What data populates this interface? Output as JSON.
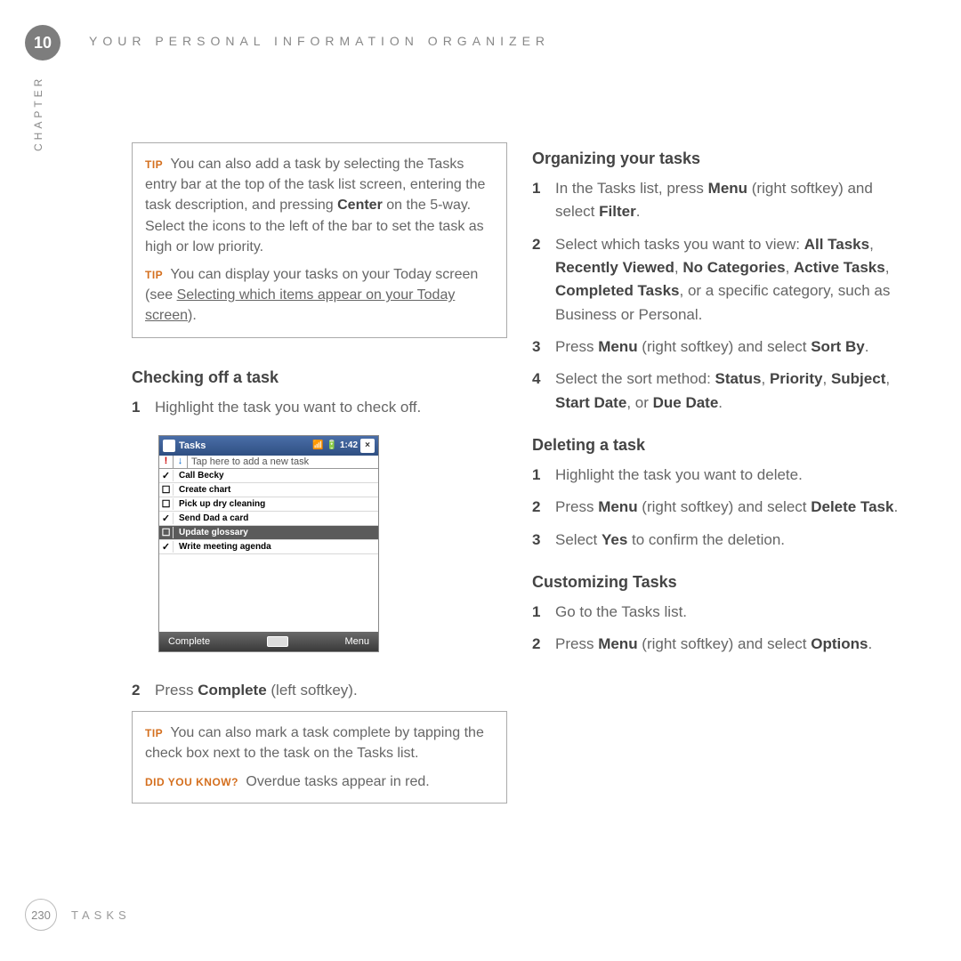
{
  "chapter": {
    "number": "10",
    "label": "CHAPTER"
  },
  "header": "YOUR PERSONAL INFORMATION ORGANIZER",
  "footer": {
    "page": "230",
    "section": "TASKS"
  },
  "left": {
    "tipbox1": {
      "tip1_label": "TIP",
      "tip1_a": "You can also add a task by selecting the Tasks entry bar at the top of the task list screen, entering the task description, and pressing ",
      "tip1_bold": "Center",
      "tip1_b": " on the 5-way. Select the icons to the left of the bar to set the task as high or low priority.",
      "tip2_label": "TIP",
      "tip2_a": "You can display your tasks on your Today screen (see ",
      "tip2_link": "Selecting which items appear on your Today screen",
      "tip2_b": ")."
    },
    "sec1_title": "Checking off a task",
    "step1_num": "1",
    "step1_txt": "Highlight the task you want to check off.",
    "phone": {
      "title": "Tasks",
      "time": "1:42",
      "close": "×",
      "priority_hi": "!",
      "priority_lo": "↓",
      "input_placeholder": "Tap here to add a new task",
      "rows": [
        {
          "chk": "✓",
          "name": "Call Becky",
          "sel": false
        },
        {
          "chk": "☐",
          "name": "Create chart",
          "sel": false
        },
        {
          "chk": "☐",
          "name": "Pick up dry cleaning",
          "sel": false
        },
        {
          "chk": "✓",
          "name": "Send Dad a card",
          "sel": false
        },
        {
          "chk": "☐",
          "name": "Update glossary",
          "sel": true
        },
        {
          "chk": "✓",
          "name": "Write meeting agenda",
          "sel": false
        }
      ],
      "left_soft": "Complete",
      "right_soft": "Menu"
    },
    "step2_num": "2",
    "step2_a": "Press ",
    "step2_bold": "Complete",
    "step2_b": " (left softkey).",
    "tipbox2": {
      "tip_label": "TIP",
      "tip_txt": "You can also mark a task complete by tapping the check box next to the task on the Tasks list.",
      "dyk_label": "DID YOU KNOW?",
      "dyk_txt": "Overdue tasks appear in red."
    }
  },
  "right": {
    "sec1_title": "Organizing your tasks",
    "s1_1n": "1",
    "s1_1a": "In the Tasks list, press ",
    "s1_1b1": "Menu",
    "s1_1m": " (right softkey) and select ",
    "s1_1b2": "Filter",
    "s1_1e": ".",
    "s1_2n": "2",
    "s1_2a": "Select which tasks you want to view: ",
    "s1_2b1": "All Tasks",
    "s1_2c1": ", ",
    "s1_2b2": "Recently Viewed",
    "s1_2c2": ", ",
    "s1_2b3": "No Categories",
    "s1_2c3": ", ",
    "s1_2b4": "Active Tasks",
    "s1_2c4": ", ",
    "s1_2b5": "Completed Tasks",
    "s1_2e": ", or a specific category, such as Business or Personal.",
    "s1_3n": "3",
    "s1_3a": "Press ",
    "s1_3b1": "Menu",
    "s1_3m": " (right softkey) and select ",
    "s1_3b2": "Sort By",
    "s1_3e": ".",
    "s1_4n": "4",
    "s1_4a": "Select the sort method: ",
    "s1_4b1": "Status",
    "s1_4c1": ", ",
    "s1_4b2": "Priority",
    "s1_4c2": ", ",
    "s1_4b3": "Subject",
    "s1_4c3": ", ",
    "s1_4b4": "Start Date",
    "s1_4c4": ", or ",
    "s1_4b5": "Due Date",
    "s1_4e": ".",
    "sec2_title": "Deleting a task",
    "s2_1n": "1",
    "s2_1": "Highlight the task you want to delete.",
    "s2_2n": "2",
    "s2_2a": "Press ",
    "s2_2b1": "Menu",
    "s2_2m": " (right softkey) and select ",
    "s2_2b2": "Delete Task",
    "s2_2e": ".",
    "s2_3n": "3",
    "s2_3a": "Select ",
    "s2_3b": "Yes",
    "s2_3e": " to confirm the deletion.",
    "sec3_title": "Customizing Tasks",
    "s3_1n": "1",
    "s3_1": "Go to the Tasks list.",
    "s3_2n": "2",
    "s3_2a": "Press ",
    "s3_2b1": "Menu",
    "s3_2m": " (right softkey) and select ",
    "s3_2b2": "Options",
    "s3_2e": "."
  }
}
